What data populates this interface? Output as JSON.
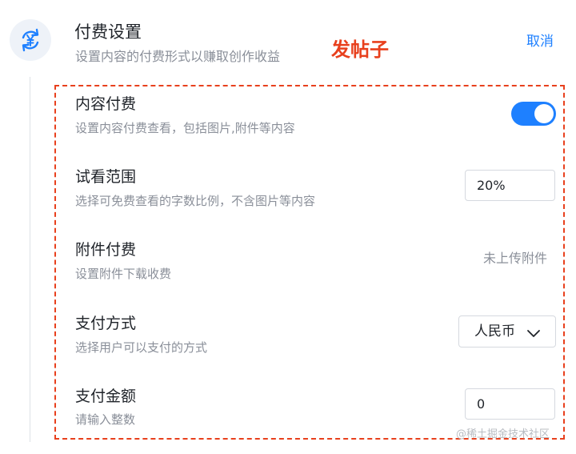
{
  "header": {
    "icon": "yen-refresh-icon",
    "title": "付费设置",
    "description": "设置内容的付费形式以赚取创作收益",
    "annotation": "发帖子",
    "cancel_label": "取消"
  },
  "colors": {
    "accent": "#1e80ff",
    "annotation": "#e8401d",
    "text_primary": "#1f2329",
    "text_secondary": "#8a8f99"
  },
  "settings": {
    "content_pay": {
      "title": "内容付费",
      "description": "设置内容付费查看，包括图片,附件等内容",
      "enabled": true
    },
    "preview_range": {
      "title": "试看范围",
      "description": "选择可免费查看的字数比例，不含图片等内容",
      "value": "20%"
    },
    "attachment_pay": {
      "title": "附件付费",
      "description": "设置附件下载收费",
      "status": "未上传附件"
    },
    "payment_method": {
      "title": "支付方式",
      "description": "选择用户可以支付的方式",
      "selected": "人民币"
    },
    "amount": {
      "title": "支付金额",
      "description": "请输入整数",
      "value": "0"
    }
  },
  "watermark": "@稀土掘金技术社区"
}
